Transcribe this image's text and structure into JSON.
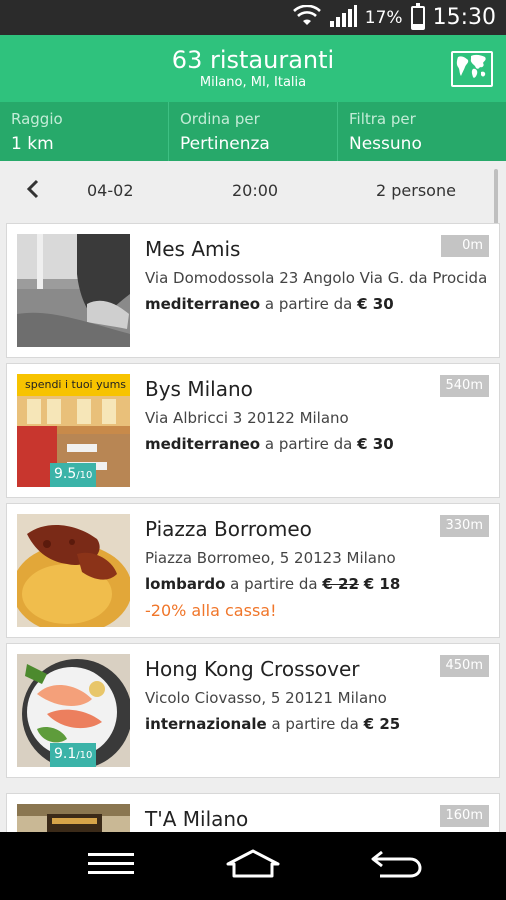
{
  "status_bar": {
    "battery_percent": "17%",
    "battery_level": 0.17,
    "time": "15:30",
    "icons": [
      "wifi-icon",
      "signal-icon",
      "battery-icon"
    ]
  },
  "header": {
    "title": "63 ristauranti",
    "subtitle": "Milano, MI, Italia",
    "map_icon": "world-map-icon"
  },
  "filters": [
    {
      "label": "Raggio",
      "value": "1 km"
    },
    {
      "label": "Ordina per",
      "value": "Pertinenza"
    },
    {
      "label": "Filtra per",
      "value": "Nessuno"
    }
  ],
  "booking": {
    "date": "04-02",
    "time": "20:00",
    "people": "2 persone"
  },
  "restaurants": [
    {
      "name": "Mes Amis",
      "address": "Via Domodossola 23 Angolo Via G. da Procida",
      "cuisine": "mediterraneo",
      "price_prefix": "a partire da",
      "price": "€ 30",
      "distance": "0m"
    },
    {
      "name": "Bys Milano",
      "address": "Via Albricci 3 20122 Milano",
      "cuisine": "mediterraneo",
      "price_prefix": "a partire da",
      "price": "€ 30",
      "distance": "540m",
      "badge": "spendi i tuoi yums",
      "rating": "9.5",
      "rating_scale": "/10"
    },
    {
      "name": "Piazza Borromeo",
      "address": "Piazza Borromeo, 5 20123 Milano",
      "cuisine": "lombardo",
      "price_prefix": "a partire da",
      "old_price": "€ 22",
      "price": "€ 18",
      "promo": "-20% alla cassa!",
      "distance": "330m"
    },
    {
      "name": "Hong Kong Crossover",
      "address": "Vicolo Ciovasso, 5 20121 Milano",
      "cuisine": "internazionale",
      "price_prefix": "a partire da",
      "price": "€ 25",
      "distance": "450m",
      "rating": "9.1",
      "rating_scale": "/10"
    },
    {
      "name": "T'A Milano",
      "distance": "160m"
    }
  ],
  "nav": {
    "icons": [
      "menu-icon",
      "home-icon",
      "back-icon"
    ]
  },
  "colors": {
    "header_green": "#2fc27d",
    "filter_green": "#27a96a",
    "promo_orange": "#f0762a",
    "rating_teal": "#3bb3a8",
    "yums_yellow": "#f7c300"
  }
}
